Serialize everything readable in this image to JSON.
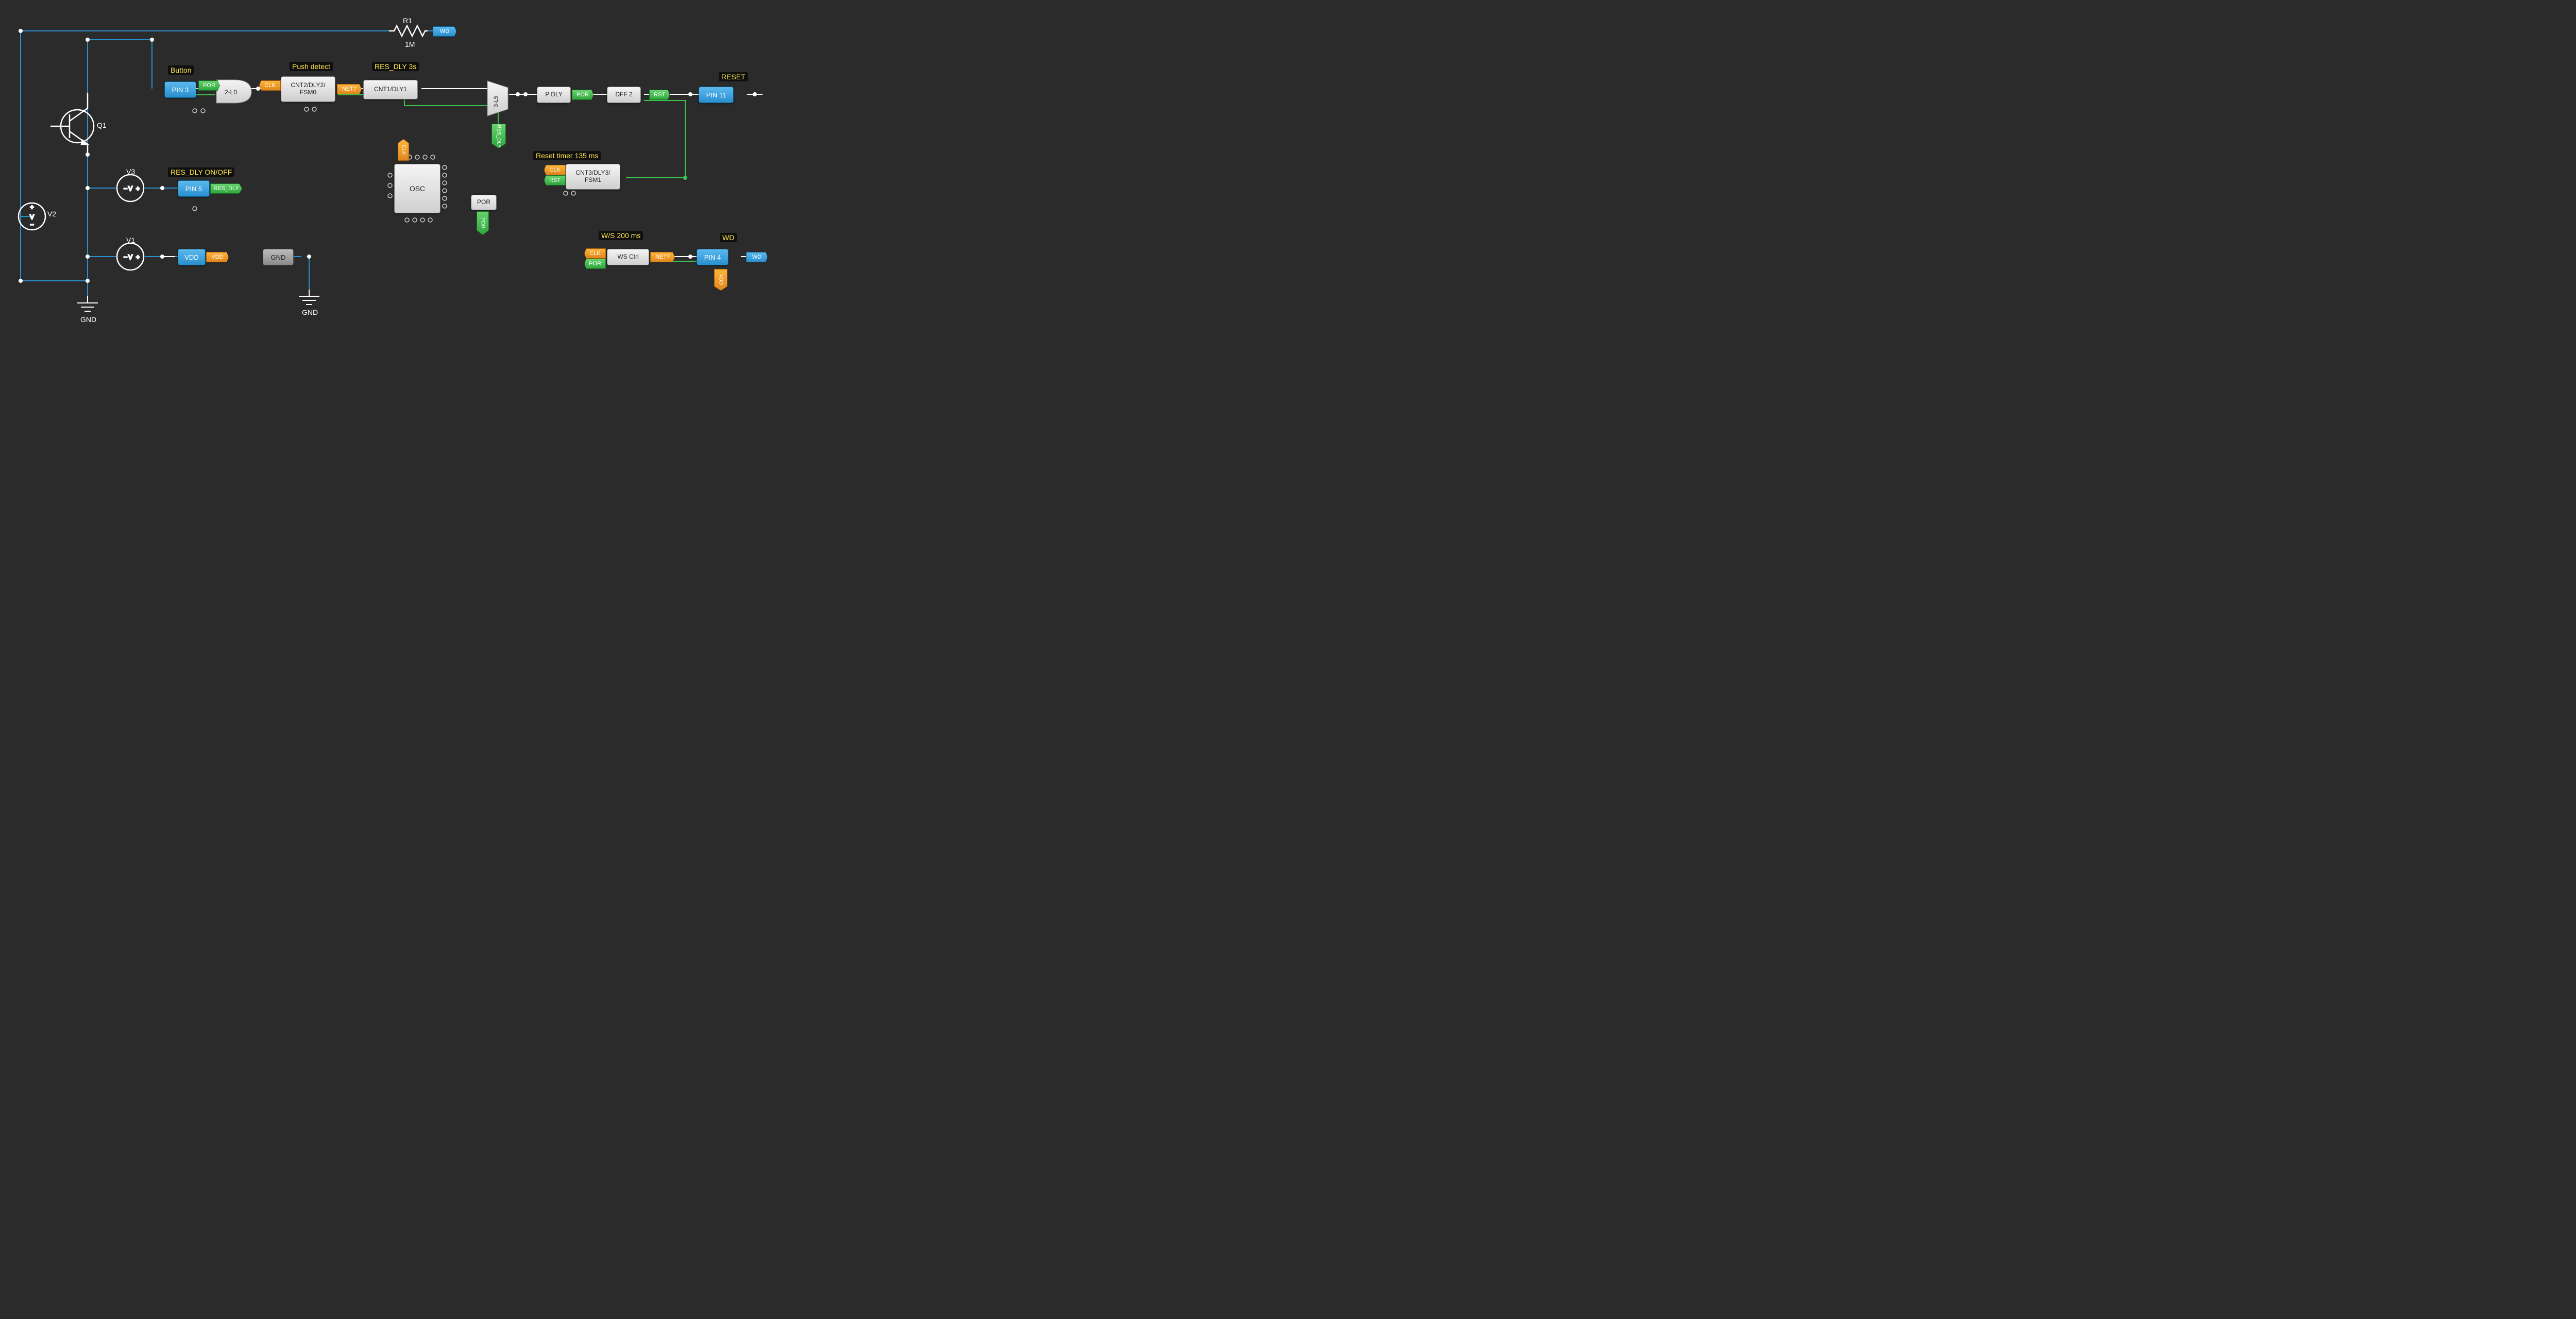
{
  "labels": {
    "R1": "R1",
    "R1v": "1M",
    "WD": "WD",
    "Q1": "Q1",
    "V1": "V1",
    "V2": "V2",
    "V3": "V3",
    "GND": "GND",
    "Button": "Button",
    "PushDetect": "Push detect",
    "RESDLY3s": "RES_DLY 3s",
    "RESET": "RESET",
    "ResetTimer": "Reset timer 135 ms",
    "WS200": "W/S 200 ms",
    "RESDLYONOFF": "RES_DLY ON/OFF"
  },
  "pins": {
    "p3": "PIN 3",
    "p5": "PIN 5",
    "p11": "PIN 11",
    "p4": "PIN 4",
    "vdd": "VDD",
    "gnd": "GND"
  },
  "blocks": {
    "l0": "2-L0",
    "fsm0": "CNT2/DLY2/\nFSM0",
    "dly1": "CNT1/DLY1",
    "l5": "3-L5",
    "pdly": "P DLY",
    "dff2": "DFF 2",
    "fsm1": "CNT3/DLY3/\nFSM1",
    "ws": "WS Ctrl",
    "osc": "OSC",
    "por": "POR"
  },
  "tags": {
    "POR": "POR",
    "CLK": "CLK",
    "NET7": "NET7",
    "RST": "RST",
    "RES_DLY": "RES_DLY",
    "VDD": "VDD",
    "WD": "WD"
  }
}
